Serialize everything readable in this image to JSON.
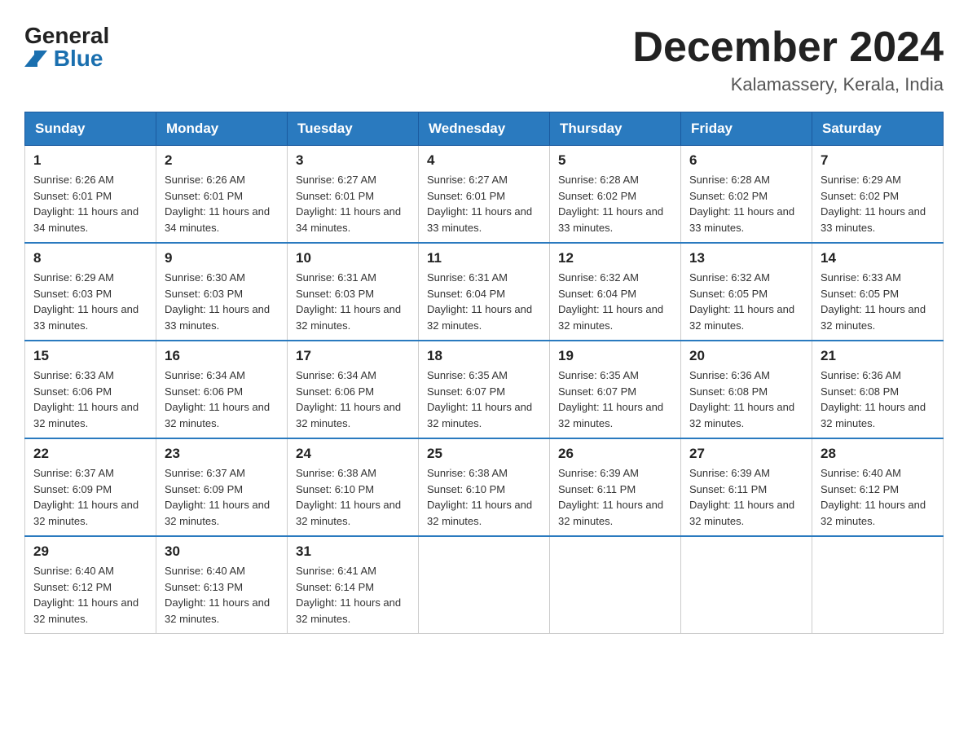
{
  "header": {
    "logo_general": "General",
    "logo_blue": "Blue",
    "month_title": "December 2024",
    "location": "Kalamassery, Kerala, India"
  },
  "days_of_week": [
    "Sunday",
    "Monday",
    "Tuesday",
    "Wednesday",
    "Thursday",
    "Friday",
    "Saturday"
  ],
  "weeks": [
    [
      {
        "day": "1",
        "sunrise": "6:26 AM",
        "sunset": "6:01 PM",
        "daylight": "11 hours and 34 minutes."
      },
      {
        "day": "2",
        "sunrise": "6:26 AM",
        "sunset": "6:01 PM",
        "daylight": "11 hours and 34 minutes."
      },
      {
        "day": "3",
        "sunrise": "6:27 AM",
        "sunset": "6:01 PM",
        "daylight": "11 hours and 34 minutes."
      },
      {
        "day": "4",
        "sunrise": "6:27 AM",
        "sunset": "6:01 PM",
        "daylight": "11 hours and 33 minutes."
      },
      {
        "day": "5",
        "sunrise": "6:28 AM",
        "sunset": "6:02 PM",
        "daylight": "11 hours and 33 minutes."
      },
      {
        "day": "6",
        "sunrise": "6:28 AM",
        "sunset": "6:02 PM",
        "daylight": "11 hours and 33 minutes."
      },
      {
        "day": "7",
        "sunrise": "6:29 AM",
        "sunset": "6:02 PM",
        "daylight": "11 hours and 33 minutes."
      }
    ],
    [
      {
        "day": "8",
        "sunrise": "6:29 AM",
        "sunset": "6:03 PM",
        "daylight": "11 hours and 33 minutes."
      },
      {
        "day": "9",
        "sunrise": "6:30 AM",
        "sunset": "6:03 PM",
        "daylight": "11 hours and 33 minutes."
      },
      {
        "day": "10",
        "sunrise": "6:31 AM",
        "sunset": "6:03 PM",
        "daylight": "11 hours and 32 minutes."
      },
      {
        "day": "11",
        "sunrise": "6:31 AM",
        "sunset": "6:04 PM",
        "daylight": "11 hours and 32 minutes."
      },
      {
        "day": "12",
        "sunrise": "6:32 AM",
        "sunset": "6:04 PM",
        "daylight": "11 hours and 32 minutes."
      },
      {
        "day": "13",
        "sunrise": "6:32 AM",
        "sunset": "6:05 PM",
        "daylight": "11 hours and 32 minutes."
      },
      {
        "day": "14",
        "sunrise": "6:33 AM",
        "sunset": "6:05 PM",
        "daylight": "11 hours and 32 minutes."
      }
    ],
    [
      {
        "day": "15",
        "sunrise": "6:33 AM",
        "sunset": "6:06 PM",
        "daylight": "11 hours and 32 minutes."
      },
      {
        "day": "16",
        "sunrise": "6:34 AM",
        "sunset": "6:06 PM",
        "daylight": "11 hours and 32 minutes."
      },
      {
        "day": "17",
        "sunrise": "6:34 AM",
        "sunset": "6:06 PM",
        "daylight": "11 hours and 32 minutes."
      },
      {
        "day": "18",
        "sunrise": "6:35 AM",
        "sunset": "6:07 PM",
        "daylight": "11 hours and 32 minutes."
      },
      {
        "day": "19",
        "sunrise": "6:35 AM",
        "sunset": "6:07 PM",
        "daylight": "11 hours and 32 minutes."
      },
      {
        "day": "20",
        "sunrise": "6:36 AM",
        "sunset": "6:08 PM",
        "daylight": "11 hours and 32 minutes."
      },
      {
        "day": "21",
        "sunrise": "6:36 AM",
        "sunset": "6:08 PM",
        "daylight": "11 hours and 32 minutes."
      }
    ],
    [
      {
        "day": "22",
        "sunrise": "6:37 AM",
        "sunset": "6:09 PM",
        "daylight": "11 hours and 32 minutes."
      },
      {
        "day": "23",
        "sunrise": "6:37 AM",
        "sunset": "6:09 PM",
        "daylight": "11 hours and 32 minutes."
      },
      {
        "day": "24",
        "sunrise": "6:38 AM",
        "sunset": "6:10 PM",
        "daylight": "11 hours and 32 minutes."
      },
      {
        "day": "25",
        "sunrise": "6:38 AM",
        "sunset": "6:10 PM",
        "daylight": "11 hours and 32 minutes."
      },
      {
        "day": "26",
        "sunrise": "6:39 AM",
        "sunset": "6:11 PM",
        "daylight": "11 hours and 32 minutes."
      },
      {
        "day": "27",
        "sunrise": "6:39 AM",
        "sunset": "6:11 PM",
        "daylight": "11 hours and 32 minutes."
      },
      {
        "day": "28",
        "sunrise": "6:40 AM",
        "sunset": "6:12 PM",
        "daylight": "11 hours and 32 minutes."
      }
    ],
    [
      {
        "day": "29",
        "sunrise": "6:40 AM",
        "sunset": "6:12 PM",
        "daylight": "11 hours and 32 minutes."
      },
      {
        "day": "30",
        "sunrise": "6:40 AM",
        "sunset": "6:13 PM",
        "daylight": "11 hours and 32 minutes."
      },
      {
        "day": "31",
        "sunrise": "6:41 AM",
        "sunset": "6:14 PM",
        "daylight": "11 hours and 32 minutes."
      },
      null,
      null,
      null,
      null
    ]
  ],
  "labels": {
    "sunrise_prefix": "Sunrise: ",
    "sunset_prefix": "Sunset: ",
    "daylight_prefix": "Daylight: "
  }
}
